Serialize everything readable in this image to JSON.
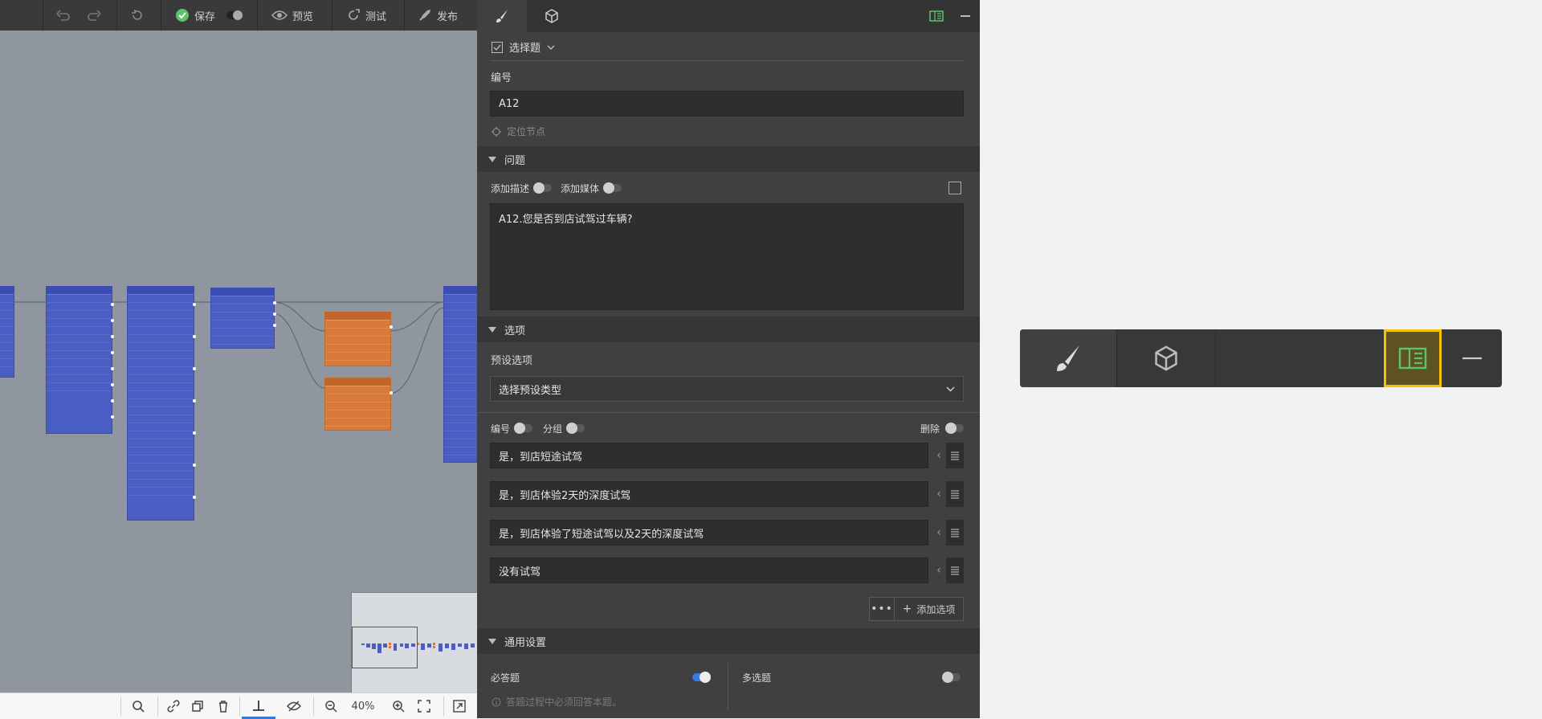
{
  "toolbar": {
    "save": "保存",
    "preview": "预览",
    "test": "测试",
    "publish": "发布"
  },
  "bottom": {
    "zoom": "40%"
  },
  "panel": {
    "tabs": [
      "brush-icon",
      "cube-icon"
    ],
    "type_label": "选择题",
    "number_label": "编号",
    "number_value": "A12",
    "locate_node": "定位节点",
    "sections": {
      "question": "问题",
      "options": "选项",
      "general": "通用设置"
    },
    "add_description": "添加描述",
    "add_media": "添加媒体",
    "question_text": "A12.您是否到店试驾过车辆?",
    "preset_label": "预设选项",
    "preset_placeholder": "选择预设类型",
    "opt_number": "编号",
    "opt_group": "分组",
    "opt_delete": "删除",
    "options": [
      "是，到店短途试驾",
      "是，到店体验2天的深度试驾",
      "是，到店体验了短途试驾以及2天的深度试驾",
      "没有试驾"
    ],
    "add_option": "添加选项",
    "required": "必答题",
    "required_on": true,
    "multi": "多选题",
    "multi_on": false,
    "required_hint": "答题过程中必须回答本题。"
  },
  "colors": {
    "accent_green": "#5ec26a",
    "highlight_yellow": "#f5c400",
    "toggle_blue": "#3a7be0",
    "node_blue": "#4a5dc2",
    "node_orange": "#d97a38"
  }
}
